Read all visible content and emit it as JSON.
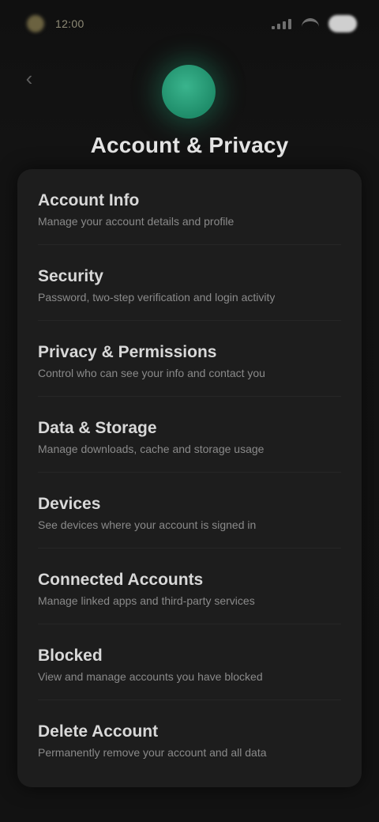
{
  "status_bar": {
    "time": "12:00",
    "icons": [
      "app-dot-icon",
      "signal-icon",
      "wifi-icon",
      "battery-icon"
    ]
  },
  "header": {
    "back_icon": "‹",
    "avatar_color": "#2a9e79",
    "title": "Account & Privacy"
  },
  "settings": [
    {
      "title": "Account Info",
      "description": "Manage your account details and profile"
    },
    {
      "title": "Security",
      "description": "Password, two-step verification and login activity"
    },
    {
      "title": "Privacy & Permissions",
      "description": "Control who can see your info and contact you"
    },
    {
      "title": "Data & Storage",
      "description": "Manage downloads, cache and storage usage"
    },
    {
      "title": "Devices",
      "description": "See devices where your account is signed in"
    },
    {
      "title": "Connected Accounts",
      "description": "Manage linked apps and third-party services"
    },
    {
      "title": "Blocked",
      "description": "View and manage accounts you have blocked"
    },
    {
      "title": "Delete Account",
      "description": "Permanently remove your account and all data"
    }
  ]
}
